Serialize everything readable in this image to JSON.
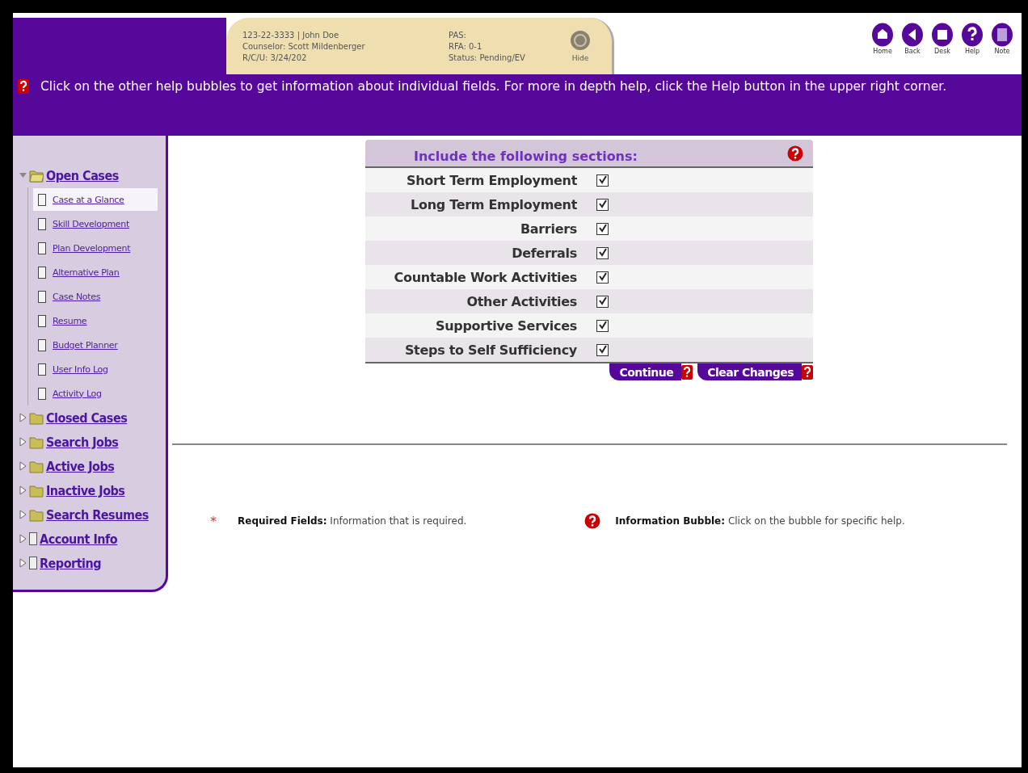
{
  "case_info": {
    "line_1": "123-22-3333 | John Doe",
    "line_2": "Counselor: Scott Mildenberger",
    "line_3": "R/C/U: 3/24/202",
    "pas": "PAS:",
    "rfa": "RFA: 0-1",
    "status": "Status: Pending/EV",
    "hide": "Hide"
  },
  "nav_buttons": [
    {
      "kind": "home",
      "label": "Home"
    },
    {
      "kind": "back",
      "label": "Back"
    },
    {
      "kind": "desk",
      "label": "Desk"
    },
    {
      "kind": "help",
      "label": "Help"
    },
    {
      "kind": "note",
      "label": "Note"
    }
  ],
  "help_text": "Click on the other help bubbles to get information about individual fields. For more in depth help, click the Help button in the upper right corner.",
  "sidebar": {
    "items": [
      {
        "label": "Open Cases",
        "kind": "folder",
        "expanded": true,
        "children": [
          {
            "label": "Case at a Glance",
            "selected": true
          },
          {
            "label": "Skill Development",
            "selected": false
          },
          {
            "label": "Plan Development",
            "selected": false
          },
          {
            "label": "Alternative Plan",
            "selected": false
          },
          {
            "label": "Case Notes",
            "selected": false
          },
          {
            "label": "Resume",
            "selected": false
          },
          {
            "label": "Budget Planner",
            "selected": false
          },
          {
            "label": "User Info Log",
            "selected": false
          },
          {
            "label": "Activity Log",
            "selected": false
          }
        ]
      },
      {
        "label": "Closed Cases",
        "kind": "folder",
        "expanded": false
      },
      {
        "label": "Search Jobs",
        "kind": "folder",
        "expanded": false
      },
      {
        "label": "Active Jobs",
        "kind": "folder",
        "expanded": false
      },
      {
        "label": "Inactive Jobs",
        "kind": "folder",
        "expanded": false
      },
      {
        "label": "Search Resumes",
        "kind": "folder",
        "expanded": false
      },
      {
        "label": "Account Info",
        "kind": "document",
        "expanded": false
      },
      {
        "label": "Reporting",
        "kind": "document",
        "expanded": false
      }
    ]
  },
  "sections": {
    "title": "Include the following sections:",
    "rows": [
      {
        "label": "Short Term Employment",
        "checked": true
      },
      {
        "label": "Long Term Employment",
        "checked": true
      },
      {
        "label": "Barriers",
        "checked": true
      },
      {
        "label": "Deferrals",
        "checked": true
      },
      {
        "label": "Countable Work Activities",
        "checked": true
      },
      {
        "label": "Other Activities",
        "checked": true
      },
      {
        "label": "Supportive Services",
        "checked": true
      },
      {
        "label": "Steps to Self Sufficiency",
        "checked": true
      }
    ],
    "buttons": [
      "Continue",
      "Clear Changes"
    ]
  },
  "legend": {
    "required_mark": "*",
    "required_label": "Required Fields:",
    "required_text": "Information that is required.",
    "bubble_label": "Information Bubble:",
    "bubble_text": "Click on the bubble for specific help."
  }
}
